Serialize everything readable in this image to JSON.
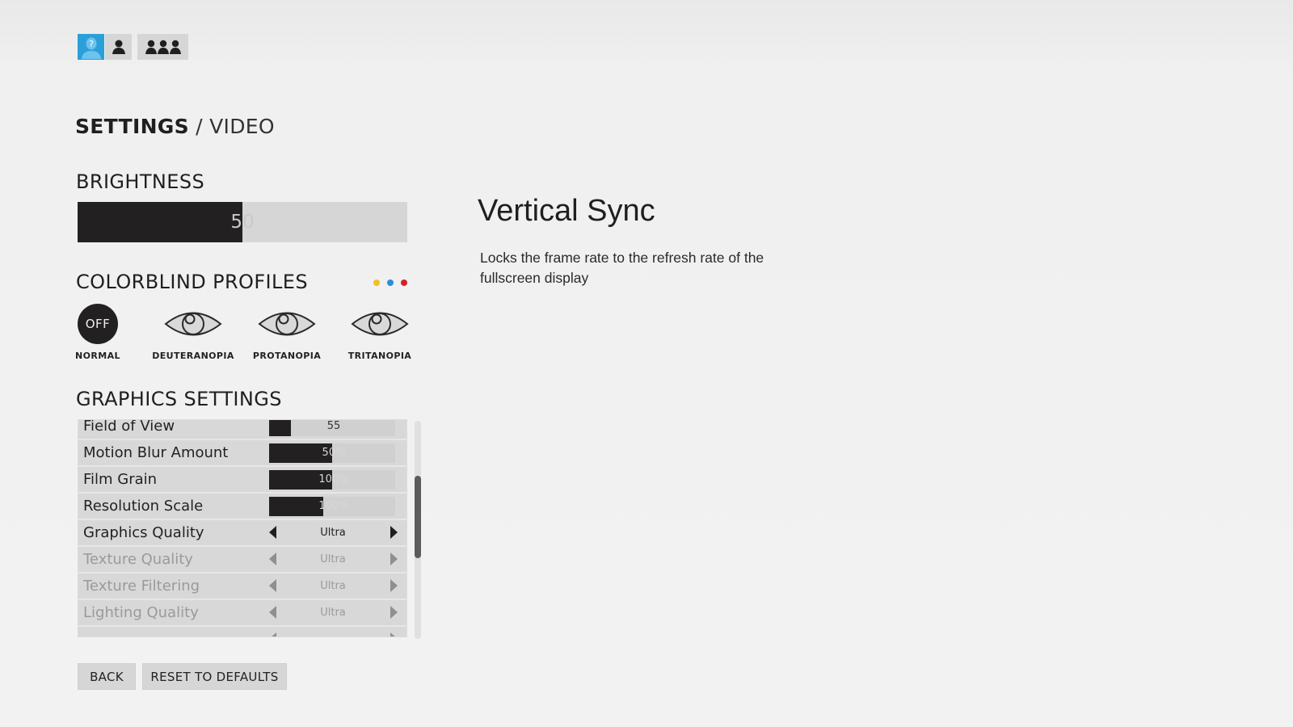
{
  "player_tabs": [
    {
      "icon": "unknown-player-icon",
      "active": true
    },
    {
      "icon": "single-player-icon",
      "active": false
    },
    {
      "icon": "group-players-icon",
      "active": false
    }
  ],
  "breadcrumb": {
    "section": "SETTINGS",
    "separator": "/",
    "page": "VIDEO"
  },
  "brightness": {
    "title": "BRIGHTNESS",
    "value": "50",
    "fraction": 0.5
  },
  "colorblind": {
    "title": "COLORBLIND PROFILES",
    "dot_colors": [
      "#f0c02a",
      "#2a8fd6",
      "#d8202a"
    ],
    "profiles": [
      {
        "label": "NORMAL",
        "icon": "off-icon",
        "icon_text": "OFF",
        "selected": true
      },
      {
        "label": "DEUTERANOPIA",
        "icon": "eye-icon",
        "selected": false
      },
      {
        "label": "PROTANOPIA",
        "icon": "eye-icon",
        "selected": false
      },
      {
        "label": "TRITANOPIA",
        "icon": "eye-icon",
        "selected": false
      }
    ]
  },
  "graphics": {
    "title": "GRAPHICS SETTINGS",
    "rows": [
      {
        "name": "Field of View",
        "type": "slider",
        "value": "55",
        "fill": 0.17,
        "disabled": false
      },
      {
        "name": "Motion Blur Amount",
        "type": "slider",
        "value": "50%",
        "fill": 0.5,
        "disabled": false
      },
      {
        "name": "Film Grain",
        "type": "slider",
        "value": "100%",
        "fill": 0.5,
        "disabled": false
      },
      {
        "name": "Resolution Scale",
        "type": "slider",
        "value": "100%",
        "fill": 0.43,
        "disabled": false
      },
      {
        "name": "Graphics Quality",
        "type": "select",
        "value": "Ultra",
        "disabled": false
      },
      {
        "name": "Texture Quality",
        "type": "select",
        "value": "Ultra",
        "disabled": true
      },
      {
        "name": "Texture Filtering",
        "type": "select",
        "value": "Ultra",
        "disabled": true
      },
      {
        "name": "Lighting Quality",
        "type": "select",
        "value": "Ultra",
        "disabled": true
      },
      {
        "name": "",
        "type": "select",
        "value": "",
        "disabled": true
      }
    ],
    "scroll": {
      "thumb_start": 0.25,
      "thumb_size": 0.38
    }
  },
  "buttons": {
    "back": "BACK",
    "reset": "RESET TO DEFAULTS"
  },
  "info": {
    "title": "Vertical Sync",
    "description": "Locks the frame rate to the refresh rate of the fullscreen display"
  }
}
